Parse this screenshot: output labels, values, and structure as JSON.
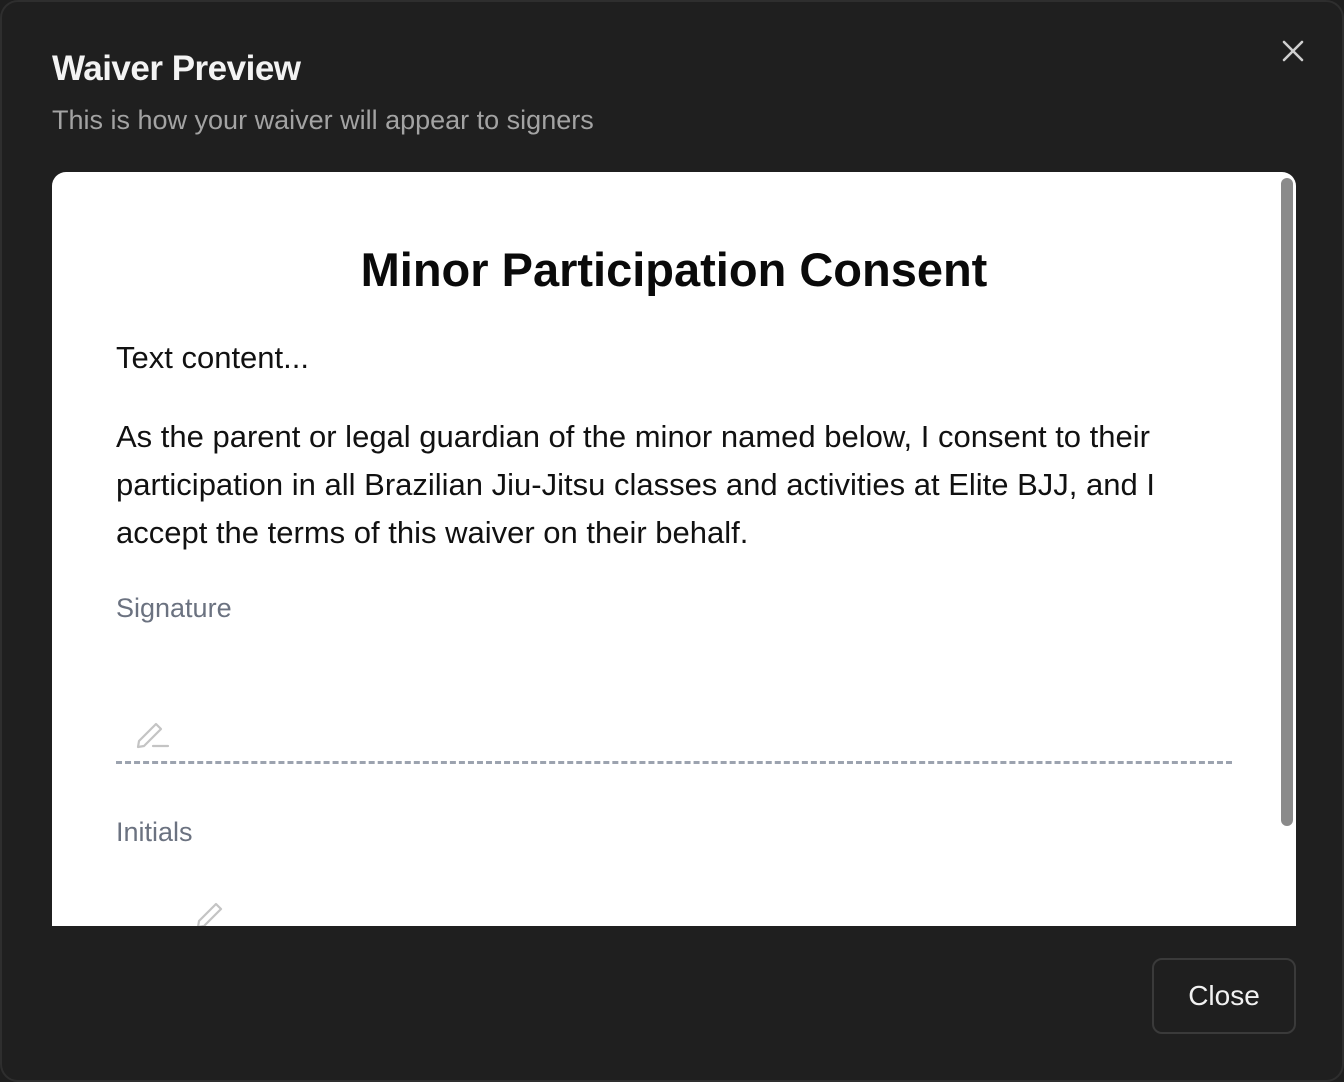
{
  "dialog": {
    "title": "Waiver Preview",
    "subtitle": "This is how your waiver will appear to signers",
    "close_icon": "close-icon",
    "close_button_label": "Close"
  },
  "preview": {
    "document_title": "Minor Participation Consent",
    "paragraphs": [
      "Text content...",
      "As the parent or legal guardian of the minor named below, I consent to their participation in all Brazilian Jiu-Jitsu classes and activities at Elite BJJ, and I accept the terms of this waiver on their behalf."
    ],
    "fields": [
      {
        "label": "Signature",
        "icon": "pen-icon"
      },
      {
        "label": "Initials",
        "icon": "pen-icon"
      }
    ]
  },
  "colors": {
    "dialog_background": "#1f1f1f",
    "preview_background": "#ffffff",
    "label_gray": "#6b7280",
    "dashed_line": "#9ca3af"
  }
}
